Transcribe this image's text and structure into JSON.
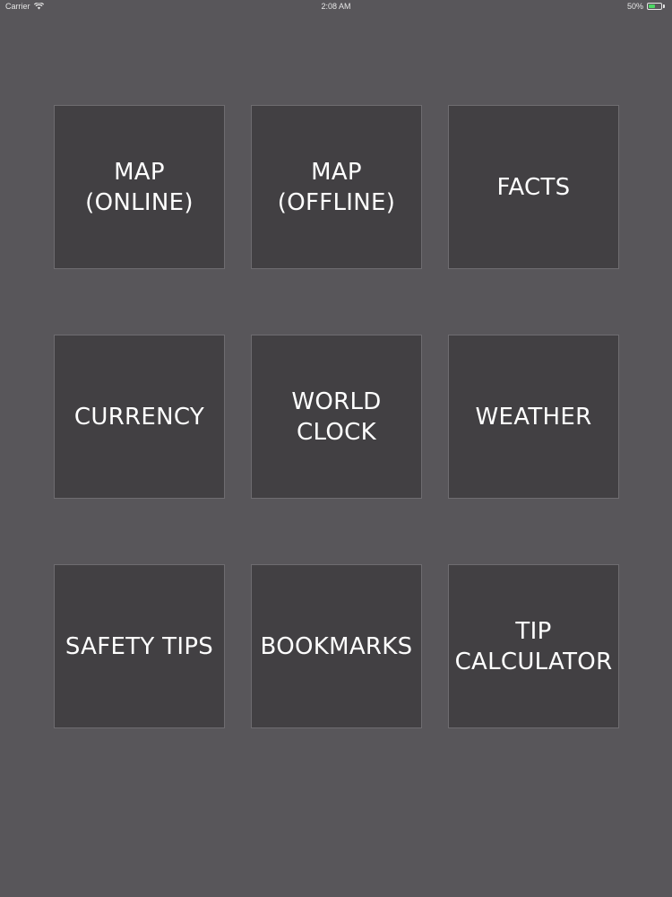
{
  "status_bar": {
    "carrier": "Carrier",
    "time": "2:08 AM",
    "battery_percent_text": "50%",
    "battery_level": 0.5,
    "battery_color": "#4cd964",
    "wifi_icon": "wifi-icon",
    "battery_icon": "battery-icon"
  },
  "colors": {
    "background": "#58565a",
    "tile_background": "#424043",
    "tile_border": "#6e6c70",
    "text": "#ffffff"
  },
  "tiles": [
    {
      "label": "MAP\n(ONLINE)"
    },
    {
      "label": "MAP\n(OFFLINE)"
    },
    {
      "label": "FACTS"
    },
    {
      "label": "CURRENCY"
    },
    {
      "label": "WORLD\nCLOCK"
    },
    {
      "label": "WEATHER"
    },
    {
      "label": "SAFETY TIPS"
    },
    {
      "label": "BOOKMARKS"
    },
    {
      "label": "TIP\nCALCULATOR"
    }
  ]
}
